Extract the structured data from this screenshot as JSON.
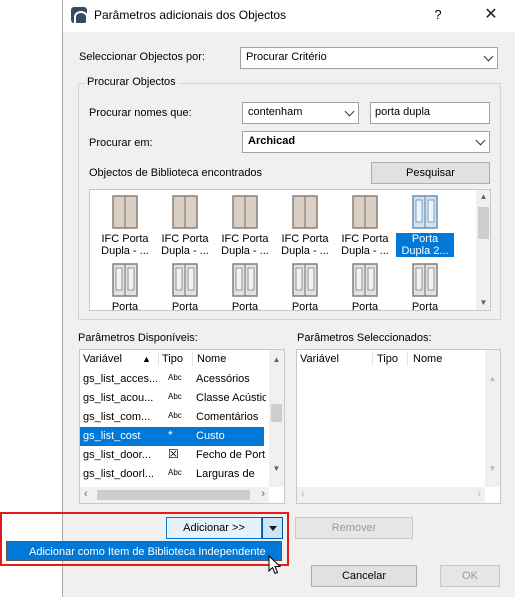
{
  "window": {
    "title": "Parâmetros adicionais dos Objectos",
    "help": "?",
    "close": "✕"
  },
  "select_by": {
    "label": "Seleccionar Objectos por:",
    "value": "Procurar Critério"
  },
  "search_group": {
    "title": "Procurar Objectos",
    "names_label": "Procurar nomes que:",
    "names_mode": "contenham",
    "names_text": "porta dupla",
    "search_in_label": "Procurar em:",
    "search_in_value": "Archicad",
    "found_label": "Objectos de Biblioteca encontrados",
    "search_button": "Pesquisar"
  },
  "library_items": [
    {
      "line1": "IFC Porta",
      "line2": "Dupla - ...",
      "selected": false,
      "icon": "double-door-icon"
    },
    {
      "line1": "IFC Porta",
      "line2": "Dupla - ...",
      "selected": false,
      "icon": "double-door-icon"
    },
    {
      "line1": "IFC Porta",
      "line2": "Dupla - ...",
      "selected": false,
      "icon": "double-door-icon"
    },
    {
      "line1": "IFC Porta",
      "line2": "Dupla - ...",
      "selected": false,
      "icon": "double-door-icon"
    },
    {
      "line1": "IFC Porta",
      "line2": "Dupla - ...",
      "selected": false,
      "icon": "double-door-icon"
    },
    {
      "line1": "Porta",
      "line2": "Dupla 2...",
      "selected": true,
      "icon": "glass-double-door-icon"
    },
    {
      "line1": "Porta",
      "line2": "",
      "selected": false,
      "icon": "double-door-icon"
    },
    {
      "line1": "Porta",
      "line2": "",
      "selected": false,
      "icon": "double-door-icon"
    },
    {
      "line1": "Porta",
      "line2": "",
      "selected": false,
      "icon": "double-door-icon"
    },
    {
      "line1": "Porta",
      "line2": "",
      "selected": false,
      "icon": "double-door-icon"
    },
    {
      "line1": "Porta",
      "line2": "",
      "selected": false,
      "icon": "double-door-icon"
    },
    {
      "line1": "Porta",
      "line2": "",
      "selected": false,
      "icon": "double-door-icon"
    }
  ],
  "available": {
    "title": "Parâmetros Disponíveis:",
    "col_variable": "Variável",
    "col_type": "Tipo",
    "col_name": "Nome",
    "rows": [
      {
        "variable": "gs_list_acces...",
        "type": "Abc",
        "name": "Acessórios",
        "selected": false
      },
      {
        "variable": "gs_list_acou...",
        "type": "Abc",
        "name": "Classe Acústic",
        "selected": false
      },
      {
        "variable": "gs_list_com...",
        "type": "Abc",
        "name": "Comentários",
        "selected": false
      },
      {
        "variable": "gs_list_cost",
        "type": "*",
        "name": "Custo",
        "selected": true
      },
      {
        "variable": "gs_list_door...",
        "type": "☒",
        "name": "Fecho de Port",
        "selected": false
      },
      {
        "variable": "gs_list_doorl...",
        "type": "Abc",
        "name": "Larguras de",
        "selected": false
      }
    ]
  },
  "selected_params": {
    "title": "Parâmetros Seleccionados:",
    "col_variable": "Variável",
    "col_type": "Tipo",
    "col_name": "Nome"
  },
  "buttons": {
    "add": "Adicionar >>",
    "remove": "Remover",
    "cancel": "Cancelar",
    "ok": "OK"
  },
  "popup": {
    "item": "Adicionar como Item de Biblioteca Independente"
  },
  "colors": {
    "selection": "#0078d7",
    "highlight_border": "#e31b1b"
  }
}
